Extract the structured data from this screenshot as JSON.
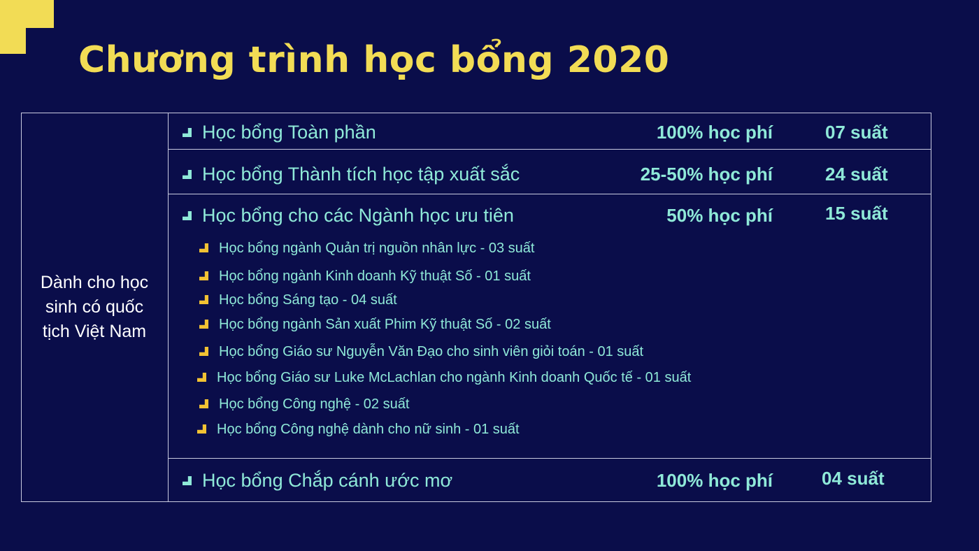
{
  "title": "Chương trình học bổng 2020",
  "colors": {
    "background": "#0a0d4a",
    "accent_yellow": "#f2dc55",
    "text_teal": "#8fe9d8",
    "bullet_yellow": "#f2c233",
    "border": "#c9cbe0"
  },
  "audience": "Dành cho học sinh có quốc tịch Việt Nam",
  "scholarships": [
    {
      "name": "Học bổng Toàn phần",
      "coverage": "100% học phí",
      "quota": "07 suất"
    },
    {
      "name": "Học bổng Thành tích học tập xuất sắc",
      "coverage": "25-50% học phí",
      "quota": "24 suất"
    },
    {
      "name": "Học bổng cho các Ngành học ưu tiên",
      "coverage": "50% học phí",
      "quota": "15 suất",
      "sub_items": [
        "Học bổng ngành Quản trị nguồn nhân lực - 03 suất",
        "Học bổng ngành Kinh doanh Kỹ thuật Số - 01 suất",
        "Học bổng Sáng tạo - 04 suất",
        "Học bổng ngành Sản xuất Phim Kỹ thuật Số - 02 suất",
        "Học bổng Giáo sư Nguyễn Văn Đạo cho sinh viên giỏi toán - 01 suất",
        "Học bổng Giáo sư Luke McLachlan cho ngành Kinh doanh Quốc tế - 01 suất",
        "Học bổng Công nghệ - 02 suất",
        "Học bổng Công nghệ dành cho nữ sinh - 01 suất"
      ]
    },
    {
      "name": "Học bổng Chắp cánh ước mơ",
      "coverage": "100% học phí",
      "quota": "04 suất"
    }
  ]
}
